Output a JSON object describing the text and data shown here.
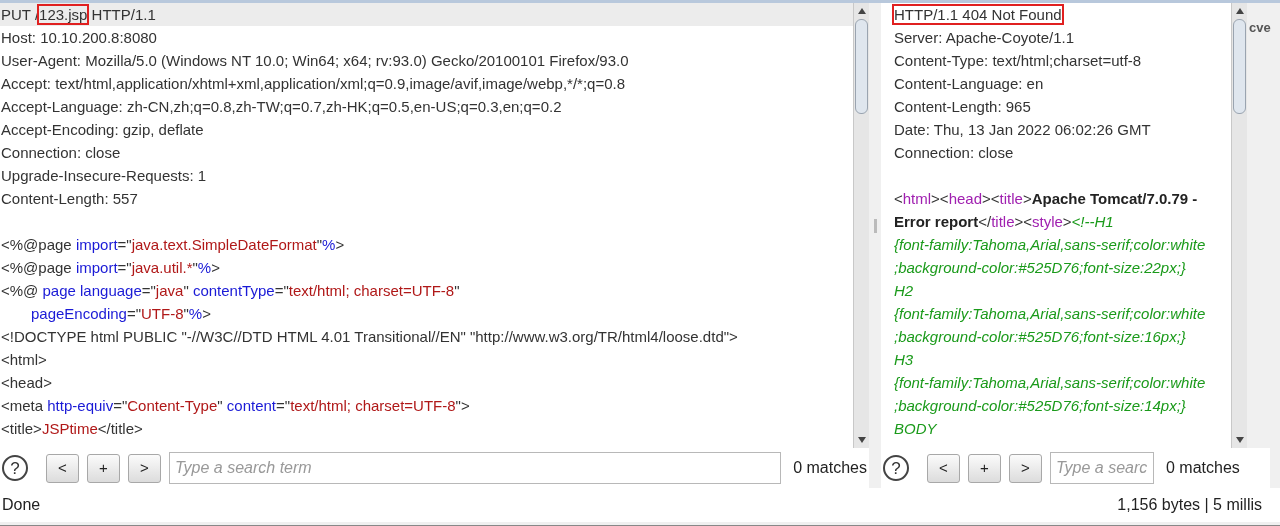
{
  "request": {
    "lines": [
      {
        "highlighted": true,
        "segments": [
          {
            "kind": "plain",
            "text": "PUT /"
          },
          {
            "kind": "boxed",
            "text": "123.jsp"
          },
          {
            "kind": "plain",
            "text": " HTTP/1.1"
          }
        ]
      },
      {
        "highlighted": false,
        "segments": [
          {
            "kind": "plain",
            "text": "Host: 10.10.200.8:8080"
          }
        ]
      },
      {
        "highlighted": false,
        "segments": [
          {
            "kind": "plain",
            "text": "User-Agent: Mozilla/5.0 (Windows NT 10.0; Win64; x64; rv:93.0) Gecko/20100101 Firefox/93.0"
          }
        ]
      },
      {
        "highlighted": false,
        "segments": [
          {
            "kind": "plain",
            "text": "Accept: text/html,application/xhtml+xml,application/xml;q=0.9,image/avif,image/webp,*/*;q=0.8"
          }
        ]
      },
      {
        "highlighted": false,
        "segments": [
          {
            "kind": "plain",
            "text": "Accept-Language: zh-CN,zh;q=0.8,zh-TW;q=0.7,zh-HK;q=0.5,en-US;q=0.3,en;q=0.2"
          }
        ]
      },
      {
        "highlighted": false,
        "segments": [
          {
            "kind": "plain",
            "text": "Accept-Encoding: gzip, deflate"
          }
        ]
      },
      {
        "highlighted": false,
        "segments": [
          {
            "kind": "plain",
            "text": "Connection: close"
          }
        ]
      },
      {
        "highlighted": false,
        "segments": [
          {
            "kind": "plain",
            "text": "Upgrade-Insecure-Requests: 1"
          }
        ]
      },
      {
        "highlighted": false,
        "segments": [
          {
            "kind": "plain",
            "text": "Content-Length: 557"
          }
        ]
      },
      {
        "highlighted": false,
        "gap_before": true,
        "segments": [
          {
            "kind": "plain",
            "text": "<%@page "
          },
          {
            "kind": "attr",
            "text": "import"
          },
          {
            "kind": "plain",
            "text": "=\""
          },
          {
            "kind": "value",
            "text": "java.text.SimpleDateFormat"
          },
          {
            "kind": "plain",
            "text": "\""
          },
          {
            "kind": "attr",
            "text": "%"
          },
          {
            "kind": "plain",
            "text": ">"
          }
        ]
      },
      {
        "highlighted": false,
        "segments": [
          {
            "kind": "plain",
            "text": "<%@page "
          },
          {
            "kind": "attr",
            "text": "import"
          },
          {
            "kind": "plain",
            "text": "=\""
          },
          {
            "kind": "value",
            "text": "java.util.*"
          },
          {
            "kind": "plain",
            "text": "\""
          },
          {
            "kind": "attr",
            "text": "%"
          },
          {
            "kind": "plain",
            "text": ">"
          }
        ]
      },
      {
        "highlighted": false,
        "segments": [
          {
            "kind": "plain",
            "text": "<%@ "
          },
          {
            "kind": "attr",
            "text": "page language"
          },
          {
            "kind": "plain",
            "text": "=\""
          },
          {
            "kind": "value",
            "text": "java"
          },
          {
            "kind": "plain",
            "text": "\" "
          },
          {
            "kind": "attr",
            "text": "contentType"
          },
          {
            "kind": "plain",
            "text": "=\""
          },
          {
            "kind": "value",
            "text": "text/html; charset=UTF-8"
          },
          {
            "kind": "plain",
            "text": "\""
          }
        ]
      },
      {
        "highlighted": false,
        "indented": true,
        "segments": [
          {
            "kind": "attr",
            "text": "pageEncoding"
          },
          {
            "kind": "plain",
            "text": "=\""
          },
          {
            "kind": "value",
            "text": "UTF-8"
          },
          {
            "kind": "plain",
            "text": "\""
          },
          {
            "kind": "attr",
            "text": "%"
          },
          {
            "kind": "plain",
            "text": ">"
          }
        ]
      },
      {
        "highlighted": false,
        "segments": [
          {
            "kind": "plain",
            "text": "<!DOCTYPE html PUBLIC \"-//W3C//DTD HTML 4.01 Transitional//EN\" \"http://www.w3.org/TR/html4/loose.dtd\">"
          }
        ]
      },
      {
        "highlighted": false,
        "segments": [
          {
            "kind": "plain",
            "text": "<html>"
          }
        ]
      },
      {
        "highlighted": false,
        "segments": [
          {
            "kind": "plain",
            "text": "<head>"
          }
        ]
      },
      {
        "highlighted": false,
        "segments": [
          {
            "kind": "plain",
            "text": "<meta "
          },
          {
            "kind": "attr",
            "text": "http-equiv"
          },
          {
            "kind": "plain",
            "text": "=\""
          },
          {
            "kind": "value",
            "text": "Content-Type"
          },
          {
            "kind": "plain",
            "text": "\" "
          },
          {
            "kind": "attr",
            "text": "content"
          },
          {
            "kind": "plain",
            "text": "=\""
          },
          {
            "kind": "value",
            "text": "text/html; charset=UTF-8"
          },
          {
            "kind": "plain",
            "text": "\">"
          }
        ]
      },
      {
        "highlighted": false,
        "segments": [
          {
            "kind": "plain",
            "text": "<title>"
          },
          {
            "kind": "value",
            "text": "JSPtime"
          },
          {
            "kind": "plain",
            "text": "</title>"
          }
        ]
      }
    ],
    "search": {
      "help": "?",
      "prev": "<",
      "add": "+",
      "next": ">",
      "placeholder": "Type a search term",
      "matches": "0 matches"
    }
  },
  "response": {
    "lines": [
      {
        "segments": [
          {
            "kind": "boxed",
            "text": "HTTP/1.1 404 Not Found"
          }
        ]
      },
      {
        "segments": [
          {
            "kind": "plain",
            "text": "Server: Apache-Coyote/1.1"
          }
        ]
      },
      {
        "segments": [
          {
            "kind": "plain",
            "text": "Content-Type: text/html;charset=utf-8"
          }
        ]
      },
      {
        "segments": [
          {
            "kind": "plain",
            "text": "Content-Language: en"
          }
        ]
      },
      {
        "segments": [
          {
            "kind": "plain",
            "text": "Content-Length: 965"
          }
        ]
      },
      {
        "segments": [
          {
            "kind": "plain",
            "text": "Date: Thu, 13 Jan 2022 06:02:26 GMT"
          }
        ]
      },
      {
        "segments": [
          {
            "kind": "plain",
            "text": "Connection: close"
          }
        ]
      },
      {
        "gap_before": true,
        "segments": [
          {
            "kind": "plain",
            "text": "<"
          },
          {
            "kind": "tag",
            "text": "html"
          },
          {
            "kind": "plain",
            "text": "><"
          },
          {
            "kind": "tag",
            "text": "head"
          },
          {
            "kind": "plain",
            "text": "><"
          },
          {
            "kind": "tag",
            "text": "title"
          },
          {
            "kind": "plain",
            "text": ">"
          },
          {
            "kind": "bold",
            "text": "Apache Tomcat/7.0.79 -"
          }
        ]
      },
      {
        "segments": [
          {
            "kind": "bold",
            "text": "Error report"
          },
          {
            "kind": "plain",
            "text": "</"
          },
          {
            "kind": "tag",
            "text": "title"
          },
          {
            "kind": "plain",
            "text": "><"
          },
          {
            "kind": "tag",
            "text": "style"
          },
          {
            "kind": "plain",
            "text": ">"
          },
          {
            "kind": "comment",
            "text": "<!--H1"
          }
        ]
      },
      {
        "segments": [
          {
            "kind": "comment",
            "text": "{font-family:Tahoma,Arial,sans-serif;color:white"
          }
        ]
      },
      {
        "segments": [
          {
            "kind": "comment",
            "text": ";background-color:#525D76;font-size:22px;}"
          }
        ]
      },
      {
        "segments": [
          {
            "kind": "comment",
            "text": "H2"
          }
        ]
      },
      {
        "segments": [
          {
            "kind": "comment",
            "text": "{font-family:Tahoma,Arial,sans-serif;color:white"
          }
        ]
      },
      {
        "segments": [
          {
            "kind": "comment",
            "text": ";background-color:#525D76;font-size:16px;}"
          }
        ]
      },
      {
        "segments": [
          {
            "kind": "comment",
            "text": "H3"
          }
        ]
      },
      {
        "segments": [
          {
            "kind": "comment",
            "text": "{font-family:Tahoma,Arial,sans-serif;color:white"
          }
        ]
      },
      {
        "segments": [
          {
            "kind": "comment",
            "text": ";background-color:#525D76;font-size:14px;}"
          }
        ]
      },
      {
        "segments": [
          {
            "kind": "comment",
            "text": "BODY"
          }
        ]
      }
    ],
    "search": {
      "help": "?",
      "prev": "<",
      "add": "+",
      "next": ">",
      "placeholder": "Type a searc",
      "matches": "0 matches"
    }
  },
  "side_label": "cve",
  "status_bar": {
    "left": "Done",
    "right": "1,156 bytes | 5 millis"
  }
}
